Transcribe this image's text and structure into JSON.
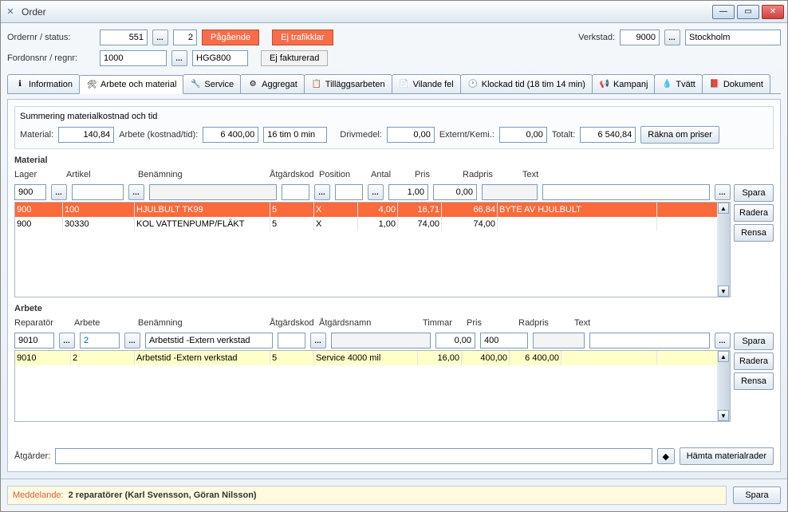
{
  "window": {
    "title": "Order"
  },
  "header": {
    "ordernr_label": "Ordernr / status:",
    "ordernr": "551",
    "status_num": "2",
    "status1": "Pågående",
    "status2": "Ej trafikklar",
    "verkstad_label": "Verkstad:",
    "verkstad": "9000",
    "verkstad_name": "Stockholm",
    "fordon_label": "Fordonsnr / regnr:",
    "fordon": "1000",
    "regnr": "HGG800",
    "faktura": "Ej fakturerad"
  },
  "tabs": [
    "Information",
    "Arbete och material",
    "Service",
    "Aggregat",
    "Tilläggsarbeten",
    "Vilande fel",
    "Klockad tid (18 tim 14 min)",
    "Kampanj",
    "Tvätt",
    "Dokument"
  ],
  "summary": {
    "title": "Summering materialkostnad och tid",
    "material_lbl": "Material:",
    "material": "140,84",
    "arbete_lbl": "Arbete (kostnad/tid):",
    "arbete_kost": "6 400,00",
    "arbete_tid": "16 tim 0 min",
    "driv_lbl": "Drivmedel:",
    "driv": "0,00",
    "ext_lbl": "Externt/Kemi.:",
    "ext": "0,00",
    "tot_lbl": "Totalt:",
    "tot": "6 540,84",
    "recalc": "Räkna om priser"
  },
  "material": {
    "title": "Material",
    "headers": {
      "lager": "Lager",
      "artikel": "Artikel",
      "benamning": "Benämning",
      "atgard": "Åtgärdskod",
      "pos": "Position",
      "antal": "Antal",
      "pris": "Pris",
      "radpris": "Radpris",
      "text": "Text"
    },
    "input": {
      "lager": "900",
      "artikel": "",
      "antal": "1,00",
      "pris": "0,00"
    },
    "rows": [
      {
        "lager": "900",
        "artikel": "100",
        "benamning": "HJULBULT TK99",
        "atgard": "5",
        "pos": "X",
        "antal": "4,00",
        "pris": "16,71",
        "radpris": "66,84",
        "text": "BYTE AV HJULBULT",
        "sel": true
      },
      {
        "lager": "900",
        "artikel": "30330",
        "benamning": "KOL VATTENPUMP/FLÄKT",
        "atgard": "5",
        "pos": "X",
        "antal": "1,00",
        "pris": "74,00",
        "radpris": "74,00",
        "text": "",
        "sel": false
      }
    ],
    "btns": {
      "spara": "Spara",
      "radera": "Radera",
      "rensa": "Rensa"
    }
  },
  "arbete": {
    "title": "Arbete",
    "headers": {
      "rep": "Reparatör",
      "arbete": "Arbete",
      "benamning": "Benämning",
      "atgard": "Åtgärdskod",
      "atgardn": "Åtgärdsnamn",
      "timmar": "Timmar",
      "pris": "Pris",
      "radpris": "Radpris",
      "text": "Text"
    },
    "input": {
      "rep": "9010",
      "arbete": "2",
      "benamning": "Arbetstid -Extern verkstad",
      "timmar": "0,00",
      "pris": "400"
    },
    "rows": [
      {
        "rep": "9010",
        "arbete": "2",
        "benamning": "Arbetstid -Extern verkstad",
        "atgard": "5",
        "atgardn": "Service 4000 mil",
        "timmar": "16,00",
        "pris": "400,00",
        "radpris": "6 400,00",
        "text": ""
      }
    ],
    "btns": {
      "spara": "Spara",
      "radera": "Radera",
      "rensa": "Rensa"
    }
  },
  "actions": {
    "atgarder_lbl": "Åtgärder:",
    "hamta": "Hämta materialrader"
  },
  "message": {
    "label": "Meddelande:",
    "text": "2 reparatörer (Karl Svensson, Göran Nilsson)"
  },
  "footer": {
    "spara": "Spara"
  }
}
